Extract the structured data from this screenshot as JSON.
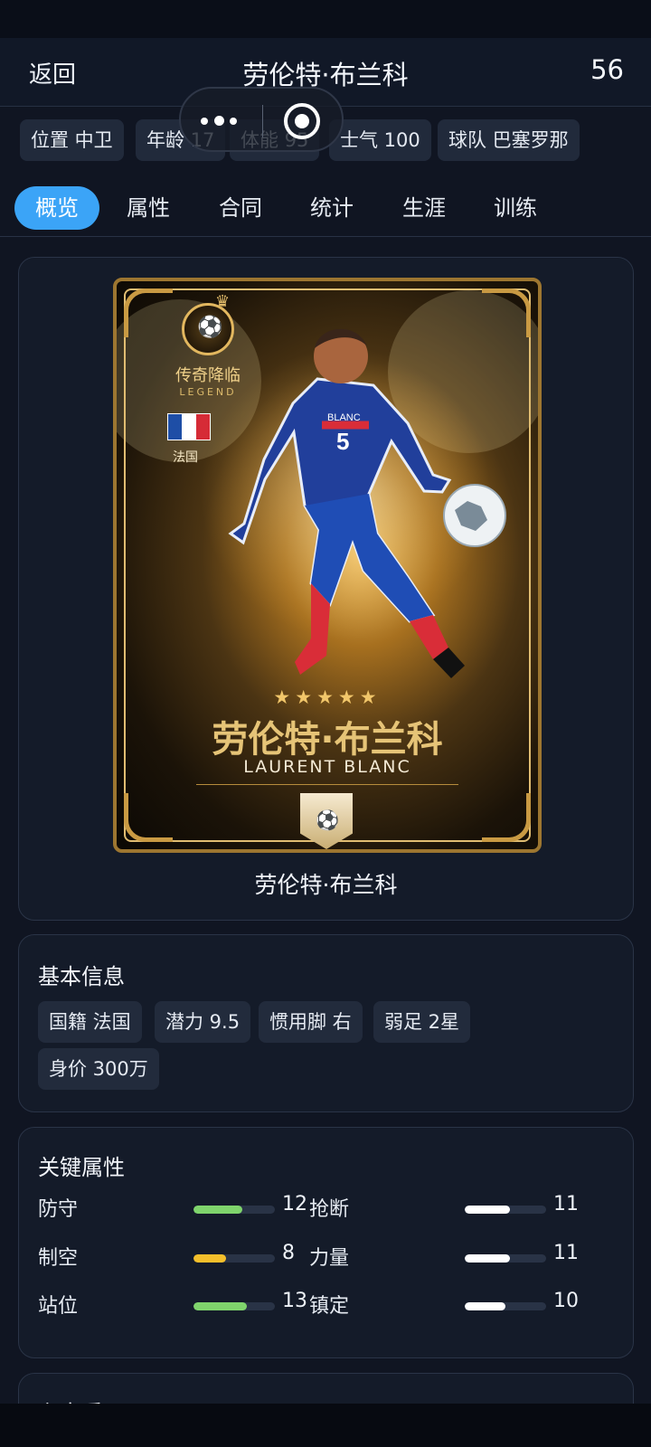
{
  "header": {
    "back_label": "返回",
    "title": "劳伦特·布兰科",
    "count": "56"
  },
  "profile_tags": [
    {
      "label": "位置 中卫"
    },
    {
      "label": "年龄 17"
    },
    {
      "label": "体能 95"
    },
    {
      "label": "士气 100"
    },
    {
      "label": "球队 巴塞罗那"
    }
  ],
  "tabs": [
    {
      "label": "概览",
      "active": true
    },
    {
      "label": "属性"
    },
    {
      "label": "合同"
    },
    {
      "label": "统计"
    },
    {
      "label": "生涯"
    },
    {
      "label": "训练"
    }
  ],
  "player_card": {
    "legend_cn": "传奇降临",
    "legend_en": "LEGEND",
    "nation": "法国",
    "stars": "★★★★★",
    "name_cn": "劳伦特·布兰科",
    "name_en": "LAURENT BLANC",
    "caption": "劳伦特·布兰科",
    "shirt_text": "BLANC",
    "shirt_number": "5"
  },
  "basic_info": {
    "title": "基本信息",
    "items": [
      {
        "label": "国籍 法国"
      },
      {
        "label": "潜力 9.5"
      },
      {
        "label": "惯用脚 右"
      },
      {
        "label": "弱足 2星"
      },
      {
        "label": "身价 300万"
      }
    ]
  },
  "key_attributes": {
    "title": "关键属性",
    "rows": [
      {
        "left_label": "防守",
        "left_value": "12",
        "left_level": 0.6,
        "left_color": "#7fd46c",
        "right_label": "抢断",
        "right_value": "11",
        "right_level": 0.55,
        "right_color": "#ffffff"
      },
      {
        "left_label": "制空",
        "left_value": "8",
        "left_level": 0.4,
        "left_color": "#f4bf2b",
        "right_label": "力量",
        "right_value": "11",
        "right_level": 0.55,
        "right_color": "#ffffff"
      },
      {
        "left_label": "站位",
        "left_value": "13",
        "left_level": 0.65,
        "left_color": "#7fd46c",
        "right_label": "镇定",
        "right_value": "10",
        "right_level": 0.5,
        "right_color": "#ffffff"
      }
    ]
  },
  "next_section": {
    "title": "主客看"
  }
}
